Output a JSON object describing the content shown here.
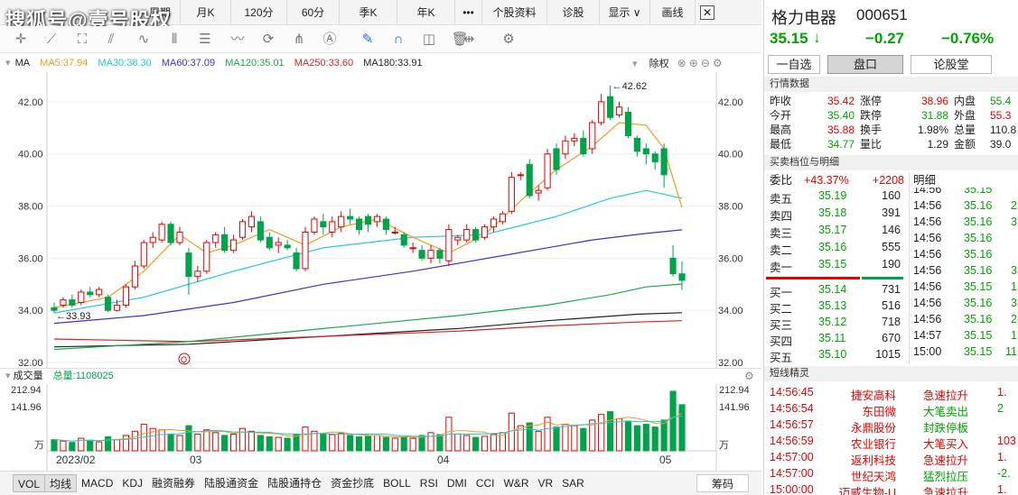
{
  "watermark": "搜狐号@壹号股权",
  "period_bar": [
    {
      "label": "周期"
    },
    {
      "label": "月K"
    },
    {
      "label": "120分"
    },
    {
      "label": "60分"
    },
    {
      "label": "季K"
    },
    {
      "label": "年K"
    },
    {
      "label": "•••"
    },
    {
      "label": "个股资料"
    },
    {
      "label": "诊股"
    },
    {
      "label": "显示 ∨"
    },
    {
      "label": "画线"
    }
  ],
  "ma_legend": {
    "title": "MA",
    "ma5": "MA5:37.94",
    "ma30": "MA30:38.30",
    "ma60": "MA60:37.09",
    "ma120": "MA120:35.01",
    "ma250": "MA250:33.60",
    "ma180": "MA180:33.91",
    "adjust": "除权"
  },
  "colors": {
    "up": "#e60000",
    "down": "#00a34a",
    "ma5": "#f39a1d",
    "ma30": "#1fc8d8",
    "ma60": "#4b2cc9",
    "ma120": "#1aaa4a",
    "ma250": "#e02020",
    "ma180": "#222222"
  },
  "price_axis": {
    "ticks": [
      "42.00",
      "40.00",
      "38.00",
      "36.00",
      "34.00",
      "32.00"
    ]
  },
  "annotations": {
    "high": "←42.62",
    "low": "←33.93",
    "marker": "Q"
  },
  "volume": {
    "title": "成交量",
    "total": "总量:1108025",
    "ticks": [
      "212.94",
      "141.96",
      "万"
    ]
  },
  "dates": [
    "2023/02",
    "03",
    "04",
    "05"
  ],
  "bottom_tabs": [
    "VOL",
    "均线",
    "MACD",
    "KDJ",
    "融资融券",
    "陆股通资金",
    "陆股通持仓",
    "资金抄底",
    "BOLL",
    "RSI",
    "DMI",
    "CCI",
    "W&R",
    "VR",
    "SAR"
  ],
  "bottom_right": "筹码",
  "stock": {
    "name": "格力电器",
    "code": "000651",
    "price": "35.15",
    "arrow": "↓",
    "change": "−0.27",
    "pct": "−0.76%"
  },
  "right_tabs": [
    "一自选",
    "盘口",
    "论股堂"
  ],
  "quote_header": "行情数据",
  "quote_rows": [
    [
      "昨收",
      "35.42",
      "涨停",
      "38.96",
      "内盘",
      "55.4"
    ],
    [
      "今开",
      "35.40",
      "跌停",
      "31.88",
      "外盘",
      "55.3"
    ],
    [
      "最高",
      "35.88",
      "换手",
      "1.98%",
      "总量",
      "110.8"
    ],
    [
      "最低",
      "34.77",
      "量比",
      "1.29",
      "金额",
      "39.0"
    ]
  ],
  "orderbook_header": "买卖档位与明细",
  "weibi": {
    "label": "委比",
    "pct": "+43.37%",
    "diff": "+2208"
  },
  "asks": [
    {
      "label": "卖五",
      "price": "35.19",
      "vol": "160"
    },
    {
      "label": "卖四",
      "price": "35.18",
      "vol": "391"
    },
    {
      "label": "卖三",
      "price": "35.17",
      "vol": "146"
    },
    {
      "label": "卖二",
      "price": "35.16",
      "vol": "555"
    },
    {
      "label": "卖一",
      "price": "35.15",
      "vol": "190"
    }
  ],
  "bids": [
    {
      "label": "买一",
      "price": "35.14",
      "vol": "731"
    },
    {
      "label": "买二",
      "price": "35.13",
      "vol": "516"
    },
    {
      "label": "买三",
      "price": "35.12",
      "vol": "718"
    },
    {
      "label": "买四",
      "price": "35.11",
      "vol": "670"
    },
    {
      "label": "买五",
      "price": "35.10",
      "vol": "1015"
    }
  ],
  "detail_header": "明细",
  "details": [
    {
      "time": "14:56",
      "price": "35.15",
      "vol": ""
    },
    {
      "time": "14:56",
      "price": "35.16",
      "vol": "2"
    },
    {
      "time": "14:56",
      "price": "35.16",
      "vol": "3"
    },
    {
      "time": "14:56",
      "price": "35.16",
      "vol": ""
    },
    {
      "time": "14:56",
      "price": "35.16",
      "vol": ""
    },
    {
      "time": "14:56",
      "price": "35.16",
      "vol": "3"
    },
    {
      "time": "14:56",
      "price": "35.15",
      "vol": "1"
    },
    {
      "time": "14:56",
      "price": "35.16",
      "vol": "3"
    },
    {
      "time": "14:56",
      "price": "35.16",
      "vol": "2"
    },
    {
      "time": "14:57",
      "price": "35.15",
      "vol": "1"
    },
    {
      "time": "15:00",
      "price": "35.15",
      "vol": "11"
    }
  ],
  "short_header": "短线精灵",
  "short_rows": [
    {
      "time": "14:56:45",
      "name": "捷安高科",
      "event": "急速拉升",
      "val": "1."
    },
    {
      "time": "14:56:54",
      "name": "东田微",
      "event": "大笔卖出",
      "val": "2"
    },
    {
      "time": "14:56:57",
      "name": "永鼎股份",
      "event": "封跌停板",
      "val": ""
    },
    {
      "time": "14:56:59",
      "name": "农业银行",
      "event": "大笔买入",
      "val": "103"
    },
    {
      "time": "14:57:00",
      "name": "返利科技",
      "event": "急速拉升",
      "val": "1."
    },
    {
      "time": "14:57:00",
      "name": "世纪天鸿",
      "event": "猛烈拉压",
      "val": "-2."
    },
    {
      "time": "15:00:00",
      "name": "迈威生物-U",
      "event": "急速拉升",
      "val": "1."
    }
  ],
  "chart_data": {
    "type": "candlestick",
    "ylim": [
      32,
      43
    ],
    "candles": [
      [
        34.1,
        34.0,
        34.3,
        33.9
      ],
      [
        34.2,
        34.4,
        34.5,
        34.1
      ],
      [
        34.4,
        34.2,
        34.6,
        34.1
      ],
      [
        34.3,
        34.7,
        34.8,
        34.2
      ],
      [
        34.7,
        34.6,
        34.9,
        34.5
      ],
      [
        34.6,
        34.8,
        34.9,
        34.5
      ],
      [
        34.5,
        34.0,
        34.6,
        33.93
      ],
      [
        34.0,
        34.2,
        34.4,
        33.95
      ],
      [
        34.2,
        34.9,
        35.0,
        34.1
      ],
      [
        34.9,
        35.7,
        35.9,
        34.8
      ],
      [
        35.7,
        36.6,
        36.7,
        35.6
      ],
      [
        36.6,
        36.8,
        37.0,
        36.4
      ],
      [
        36.7,
        37.3,
        37.4,
        36.6
      ],
      [
        37.3,
        36.6,
        37.4,
        36.5
      ],
      [
        36.6,
        37.0,
        37.2,
        36.5
      ],
      [
        36.2,
        35.3,
        36.4,
        34.6
      ],
      [
        35.3,
        35.5,
        35.7,
        35.1
      ],
      [
        35.5,
        36.6,
        36.7,
        35.4
      ],
      [
        36.6,
        36.9,
        37.0,
        36.4
      ],
      [
        36.9,
        36.3,
        37.2,
        36.2
      ],
      [
        36.3,
        36.7,
        36.9,
        36.2
      ],
      [
        36.8,
        37.4,
        37.5,
        36.7
      ],
      [
        37.2,
        37.6,
        37.8,
        37.0
      ],
      [
        37.4,
        36.7,
        37.6,
        36.6
      ],
      [
        36.8,
        36.4,
        37.0,
        36.3
      ],
      [
        36.5,
        36.6,
        36.8,
        36.2
      ],
      [
        36.5,
        36.4,
        36.7,
        36.3
      ],
      [
        36.2,
        35.6,
        36.4,
        35.5
      ],
      [
        35.6,
        37.0,
        37.2,
        35.5
      ],
      [
        37.0,
        37.5,
        37.6,
        36.9
      ],
      [
        37.4,
        37.2,
        37.7,
        36.9
      ],
      [
        37.0,
        37.4,
        37.6,
        36.8
      ],
      [
        37.2,
        37.6,
        37.8,
        37.0
      ],
      [
        37.6,
        37.5,
        37.9,
        37.3
      ],
      [
        37.5,
        37.1,
        37.6,
        36.9
      ],
      [
        37.6,
        37.3,
        37.7,
        37.0
      ],
      [
        37.4,
        37.6,
        37.7,
        37.2
      ],
      [
        37.5,
        37.1,
        37.6,
        36.9
      ],
      [
        37.0,
        37.0,
        37.2,
        36.9
      ],
      [
        36.9,
        36.5,
        37.0,
        36.4
      ],
      [
        36.4,
        36.4,
        36.6,
        36.2
      ],
      [
        36.3,
        36.0,
        36.5,
        35.9
      ],
      [
        36.0,
        36.3,
        36.5,
        35.8
      ],
      [
        36.3,
        36.0,
        36.4,
        35.8
      ],
      [
        35.9,
        37.1,
        37.3,
        35.7
      ],
      [
        36.7,
        36.8,
        36.9,
        36.5
      ],
      [
        36.7,
        37.1,
        37.3,
        36.6
      ],
      [
        37.1,
        36.7,
        37.2,
        36.6
      ],
      [
        36.8,
        37.2,
        37.3,
        36.7
      ],
      [
        37.2,
        37.5,
        37.6,
        37.0
      ],
      [
        37.4,
        37.7,
        37.8,
        37.3
      ],
      [
        37.8,
        39.1,
        39.3,
        37.7
      ],
      [
        39.2,
        39.2,
        39.3,
        39.0
      ],
      [
        39.6,
        38.4,
        39.8,
        38.3
      ],
      [
        38.5,
        38.6,
        38.8,
        38.2
      ],
      [
        38.7,
        40.0,
        40.2,
        38.6
      ],
      [
        40.2,
        39.4,
        40.4,
        39.2
      ],
      [
        40.0,
        40.5,
        40.7,
        39.8
      ],
      [
        40.5,
        40.6,
        40.8,
        40.3
      ],
      [
        40.6,
        40.0,
        40.9,
        39.9
      ],
      [
        40.2,
        41.2,
        41.3,
        40.0
      ],
      [
        41.2,
        42.0,
        42.3,
        41.1
      ],
      [
        42.2,
        41.4,
        42.62,
        41.3
      ],
      [
        41.5,
        41.8,
        42.0,
        41.4
      ],
      [
        41.6,
        40.7,
        41.8,
        40.6
      ],
      [
        40.6,
        40.1,
        40.7,
        39.9
      ],
      [
        40.2,
        40.0,
        40.4,
        39.6
      ],
      [
        40.0,
        39.7,
        40.1,
        39.4
      ],
      [
        40.2,
        39.2,
        40.4,
        38.7
      ],
      [
        36.0,
        35.4,
        36.5,
        35.3
      ],
      [
        35.4,
        35.15,
        35.88,
        34.77
      ]
    ],
    "ma": {
      "ma5": [
        [
          0,
          34.1
        ],
        [
          6,
          34.5
        ],
        [
          10,
          35.5
        ],
        [
          14,
          36.9
        ],
        [
          17,
          36.2
        ],
        [
          20,
          36.5
        ],
        [
          24,
          37.1
        ],
        [
          28,
          36.5
        ],
        [
          32,
          37.2
        ],
        [
          36,
          37.5
        ],
        [
          40,
          36.8
        ],
        [
          44,
          36.2
        ],
        [
          48,
          36.9
        ],
        [
          52,
          38.2
        ],
        [
          56,
          39.4
        ],
        [
          60,
          40.3
        ],
        [
          63,
          41.2
        ],
        [
          66,
          41.1
        ],
        [
          68,
          40.2
        ],
        [
          70,
          37.94
        ]
      ],
      "ma30": [
        [
          0,
          33.9
        ],
        [
          10,
          34.5
        ],
        [
          20,
          35.5
        ],
        [
          30,
          36.4
        ],
        [
          40,
          36.8
        ],
        [
          48,
          36.9
        ],
        [
          56,
          37.6
        ],
        [
          62,
          38.3
        ],
        [
          66,
          38.6
        ],
        [
          70,
          38.3
        ]
      ],
      "ma60": [
        [
          0,
          33.5
        ],
        [
          10,
          33.8
        ],
        [
          20,
          34.3
        ],
        [
          30,
          35.0
        ],
        [
          40,
          35.5
        ],
        [
          50,
          36.1
        ],
        [
          60,
          36.7
        ],
        [
          66,
          36.95
        ],
        [
          70,
          37.09
        ]
      ],
      "ma120": [
        [
          0,
          32.5
        ],
        [
          15,
          32.8
        ],
        [
          30,
          33.3
        ],
        [
          45,
          33.8
        ],
        [
          55,
          34.2
        ],
        [
          62,
          34.6
        ],
        [
          66,
          34.9
        ],
        [
          70,
          35.01
        ]
      ],
      "ma250": [
        [
          0,
          32.9
        ],
        [
          15,
          32.8
        ],
        [
          30,
          33.0
        ],
        [
          45,
          33.2
        ],
        [
          55,
          33.4
        ],
        [
          65,
          33.55
        ],
        [
          70,
          33.6
        ]
      ],
      "ma180": [
        [
          0,
          32.6
        ],
        [
          15,
          32.7
        ],
        [
          30,
          33.0
        ],
        [
          45,
          33.3
        ],
        [
          55,
          33.6
        ],
        [
          65,
          33.85
        ],
        [
          70,
          33.91
        ]
      ]
    },
    "volume_max": 212.94,
    "volumes": [
      40,
      35,
      30,
      45,
      38,
      32,
      50,
      40,
      55,
      70,
      95,
      80,
      75,
      60,
      55,
      90,
      60,
      75,
      65,
      55,
      60,
      80,
      70,
      55,
      50,
      48,
      45,
      60,
      85,
      70,
      60,
      58,
      62,
      55,
      50,
      52,
      55,
      48,
      45,
      50,
      45,
      55,
      65,
      58,
      120,
      60,
      55,
      48,
      52,
      60,
      65,
      135,
      90,
      100,
      70,
      120,
      85,
      95,
      90,
      80,
      110,
      130,
      140,
      115,
      105,
      90,
      95,
      85,
      110,
      212.94,
      165
    ]
  }
}
